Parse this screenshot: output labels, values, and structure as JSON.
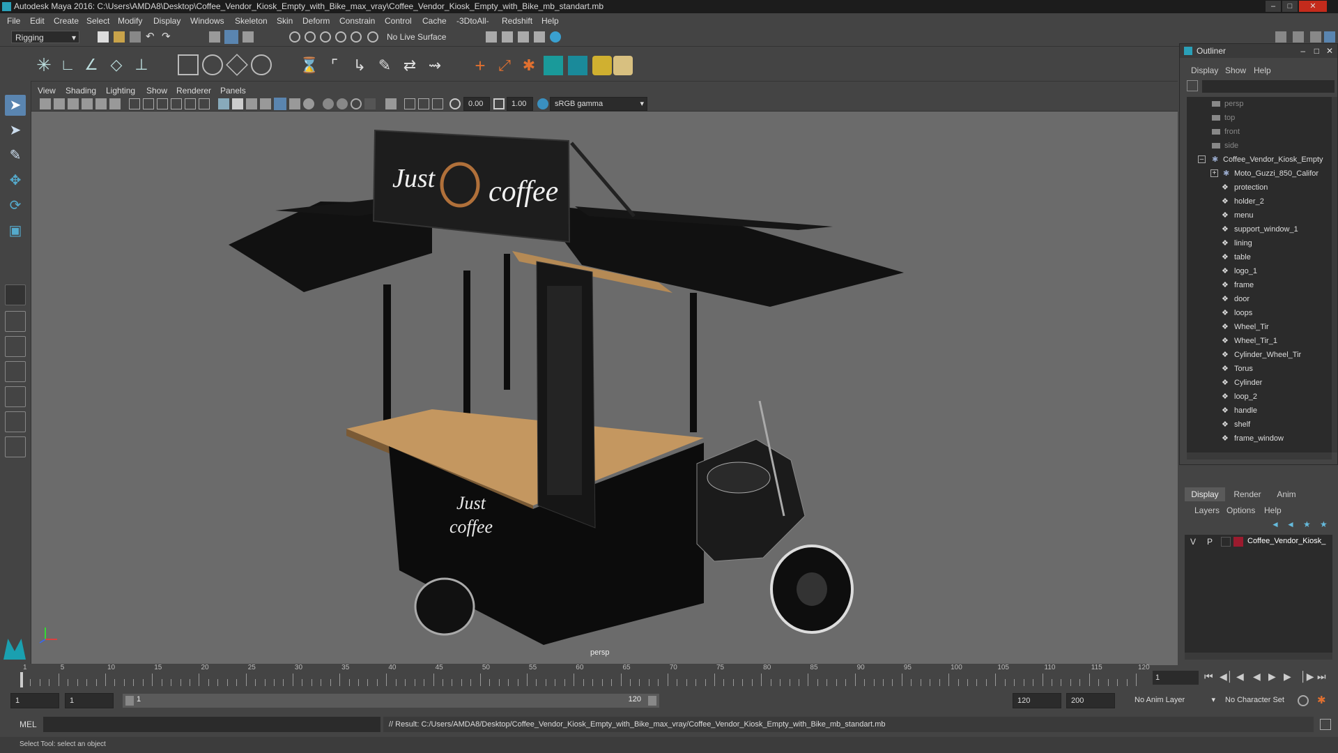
{
  "title": "Autodesk Maya 2016: C:\\Users\\AMDA8\\Desktop\\Coffee_Vendor_Kiosk_Empty_with_Bike_max_vray\\Coffee_Vendor_Kiosk_Empty_with_Bike_mb_standart.mb",
  "menu": [
    "File",
    "Edit",
    "Create",
    "Select",
    "Modify",
    "Display",
    "Windows",
    "Skeleton",
    "Skin",
    "Deform",
    "Constrain",
    "Control",
    "Cache",
    "-3DtoAll-",
    "Redshift",
    "Help"
  ],
  "status": {
    "menuset": "Rigging",
    "live_surface": "No Live Surface"
  },
  "viewport": {
    "menu": [
      "View",
      "Shading",
      "Lighting",
      "Show",
      "Renderer",
      "Panels"
    ],
    "near_value": "0.00",
    "far_value": "1.00",
    "color_space": "sRGB gamma",
    "camera_label": "persp",
    "sign_text_left": "Just",
    "sign_text_right": "coffee",
    "kiosk_text_line1": "Just",
    "kiosk_text_line2": "coffee"
  },
  "outliner": {
    "title": "Outliner",
    "menu": [
      "Display",
      "Show",
      "Help"
    ],
    "items": [
      {
        "label": "persp",
        "type": "camera"
      },
      {
        "label": "top",
        "type": "camera"
      },
      {
        "label": "front",
        "type": "camera"
      },
      {
        "label": "side",
        "type": "camera"
      },
      {
        "label": "Coffee_Vendor_Kiosk_Empty",
        "type": "group"
      },
      {
        "label": "Moto_Guzzi_850_Califor",
        "type": "subgroup"
      },
      {
        "label": "protection",
        "type": "mesh"
      },
      {
        "label": "holder_2",
        "type": "mesh"
      },
      {
        "label": "menu",
        "type": "mesh"
      },
      {
        "label": "support_window_1",
        "type": "mesh"
      },
      {
        "label": "lining",
        "type": "mesh"
      },
      {
        "label": "table",
        "type": "mesh"
      },
      {
        "label": "logo_1",
        "type": "mesh"
      },
      {
        "label": "frame",
        "type": "mesh"
      },
      {
        "label": "door",
        "type": "mesh"
      },
      {
        "label": "loops",
        "type": "mesh"
      },
      {
        "label": "Wheel_Tir",
        "type": "mesh"
      },
      {
        "label": "Wheel_Tir_1",
        "type": "mesh"
      },
      {
        "label": "Cylinder_Wheel_Tir",
        "type": "mesh"
      },
      {
        "label": "Torus",
        "type": "mesh"
      },
      {
        "label": "Cylinder",
        "type": "mesh"
      },
      {
        "label": "loop_2",
        "type": "mesh"
      },
      {
        "label": "handle",
        "type": "mesh"
      },
      {
        "label": "shelf",
        "type": "mesh"
      },
      {
        "label": "frame_window",
        "type": "mesh"
      }
    ]
  },
  "layer_editor": {
    "tabs": [
      "Display",
      "Render",
      "Anim"
    ],
    "menu": [
      "Layers",
      "Options",
      "Help"
    ],
    "layer": {
      "v": "V",
      "p": "P",
      "name": "Coffee_Vendor_Kiosk_",
      "color": "#9b1b2e"
    }
  },
  "timeline": {
    "ticks": [
      "1",
      "5",
      "10",
      "15",
      "20",
      "25",
      "30",
      "35",
      "40",
      "45",
      "50",
      "55",
      "60",
      "65",
      "70",
      "75",
      "80",
      "85",
      "90",
      "95",
      "100",
      "105",
      "110",
      "115",
      "120"
    ],
    "current_frame": "1"
  },
  "range": {
    "start": "1",
    "playback_start": "1",
    "slider_start": "1",
    "slider_end": "120",
    "playback_end": "120",
    "end": "200",
    "anim_layer": "No Anim Layer",
    "character_set": "No Character Set"
  },
  "command": {
    "lang": "MEL",
    "result": "// Result: C:/Users/AMDA8/Desktop/Coffee_Vendor_Kiosk_Empty_with_Bike_max_vray/Coffee_Vendor_Kiosk_Empty_with_Bike_mb_standart.mb"
  },
  "help_line": "Select Tool: select an object"
}
